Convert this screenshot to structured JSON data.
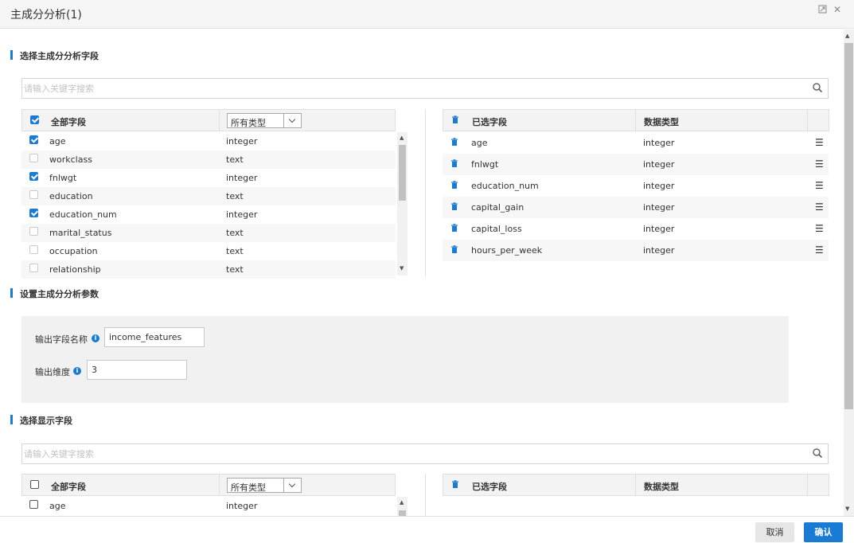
{
  "window": {
    "title": "主成分分析(1)",
    "restore_icon": "restore-icon",
    "close_icon": "close-icon"
  },
  "section1": {
    "title": "选择主成分分析字段",
    "search_placeholder": "请输入关键字搜索",
    "left": {
      "header_all": "全部字段",
      "type_filter": "所有类型",
      "rows": [
        {
          "field": "age",
          "type": "integer",
          "checked": true
        },
        {
          "field": "workclass",
          "type": "text",
          "checked": false
        },
        {
          "field": "fnlwgt",
          "type": "integer",
          "checked": true
        },
        {
          "field": "education",
          "type": "text",
          "checked": false
        },
        {
          "field": "education_num",
          "type": "integer",
          "checked": true
        },
        {
          "field": "marital_status",
          "type": "text",
          "checked": false
        },
        {
          "field": "occupation",
          "type": "text",
          "checked": false
        },
        {
          "field": "relationship",
          "type": "text",
          "checked": false
        }
      ]
    },
    "right": {
      "header_selected": "已选字段",
      "header_type": "数据类型",
      "rows": [
        {
          "field": "age",
          "type": "integer"
        },
        {
          "field": "fnlwgt",
          "type": "integer"
        },
        {
          "field": "education_num",
          "type": "integer"
        },
        {
          "field": "capital_gain",
          "type": "integer"
        },
        {
          "field": "capital_loss",
          "type": "integer"
        },
        {
          "field": "hours_per_week",
          "type": "integer"
        }
      ]
    }
  },
  "section2": {
    "title": "设置主成分分析参数",
    "output_field_label": "输出字段名称",
    "output_field_value": "income_features",
    "output_dim_label": "输出维度",
    "output_dim_value": "3"
  },
  "section3": {
    "title": "选择显示字段",
    "search_placeholder": "请输入关键字搜索",
    "left": {
      "header_all": "全部字段",
      "type_filter": "所有类型",
      "rows": [
        {
          "field": "age",
          "type": "integer",
          "checked": false
        }
      ]
    },
    "right": {
      "header_selected": "已选字段",
      "header_type": "数据类型"
    }
  },
  "footer": {
    "cancel_label": "取消",
    "ok_label": "确认"
  },
  "colors": {
    "accent": "#1a7bd5",
    "header_bg": "#f3f3f3",
    "param_bg": "#f1f1f1"
  }
}
